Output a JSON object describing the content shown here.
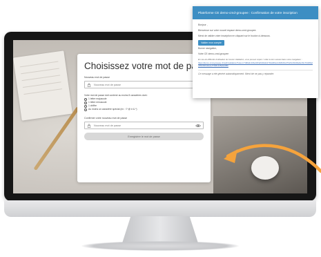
{
  "form": {
    "title": "Choisissez votre mot de passe",
    "new_password_label": "Nouveau mot de passe",
    "new_password_placeholder": "Nouveau mot de passe",
    "rules_intro": "Votre mot de passe doit contenir au moins 8 caractères dont :",
    "rules": [
      "1 lettre majuscule",
      "1 lettre minuscule",
      "1 chiffre",
      "Au moins un caractère spécial (ex : !? @ # & *)"
    ],
    "confirm_label": "Confirmer votre nouveau mot de passe",
    "confirm_placeholder": "Nouveau mot de passe",
    "submit_label": "Enregistrer le mot de passe"
  },
  "email": {
    "header": "Plateforme CE demo-cmd-groupee : Confirmation de votre inscription",
    "greeting": "Bonjour ,",
    "welcome": "Bienvenue sur votre nouvel espace demo-cmd-groupee.",
    "instruction": "Merci de valider votre inscription en cliquant sur le bouton ci-dessous.",
    "button_label": "Valider mon compte",
    "sign_off": "Bonne navigation,",
    "team": "Votre CE demo-cmd-groupee",
    "fallback": "En cas de difficulté d'utilisation du bouton Validation, vous pouvez copier / coller le lien suivant dans votre navigateur :",
    "link": "https://demo-cmd-groupee.fr/auth/validation?token=7d9fa3c1b6e02f4a5c8e9d17b3a6f0e2c4b8d91a7f3e5c2b0d6a9e4f1c7b3d8a2e5f0c9b6d4a1e7f3b8c2d5a0e9f6b",
    "auto_message": "Ce message a été généré automatiquement. Merci de ne pas y répondre."
  },
  "colors": {
    "accent": "#3d8ec3",
    "arrow": "#f5a33c"
  }
}
